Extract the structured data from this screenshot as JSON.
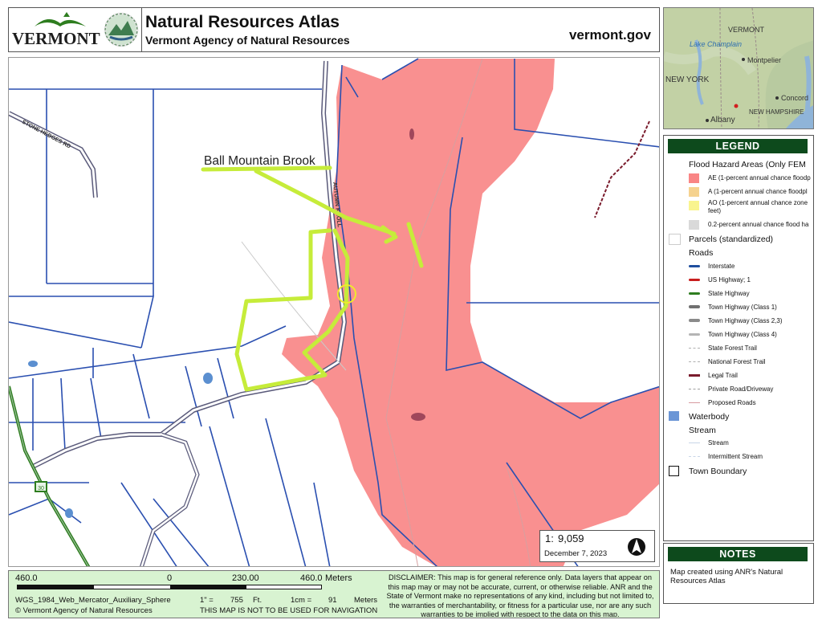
{
  "header": {
    "logo_text": "VERMONT",
    "title": "Natural Resources Atlas",
    "subtitle": "Vermont Agency of Natural Resources",
    "site": "vermont.gov"
  },
  "inset_map": {
    "labels": [
      "VERMONT",
      "Lake Champlain",
      "Montpelier",
      "NEW YORK",
      "Concord",
      "NEW HAMPSHIRE",
      "Albany"
    ]
  },
  "map": {
    "annotation": "Ball Mountain Brook",
    "road_label_1": "STONE HEDGES RD",
    "road_label_2": "AUTUMN KNOLL",
    "shield_label": "30"
  },
  "legend": {
    "title": "LEGEND",
    "flood_header": "Flood Hazard Areas (Only FEM",
    "flood_items": [
      {
        "label": "AE (1-percent annual chance floodp",
        "color": "#f98585"
      },
      {
        "label": "A (1-percent annual chance floodpl",
        "color": "#f5d28f"
      },
      {
        "label": "AO (1-percent annual chance zone",
        "label2": "feet)",
        "color": "#f9f48f"
      },
      {
        "label": "0.2-percent annual chance flood ha",
        "color": "#d9d9d9"
      }
    ],
    "parcels": "Parcels (standardized)",
    "roads_header": "Roads",
    "road_items": [
      {
        "label": "Interstate",
        "color": "#1f4e9e"
      },
      {
        "label": "US Highway; 1",
        "color": "#c81e1e"
      },
      {
        "label": "State Highway",
        "color": "#2e7d1f"
      },
      {
        "label": "Town Highway (Class 1)",
        "color": "#707070"
      },
      {
        "label": "Town Highway (Class 2,3)",
        "color": "#8a8a8a"
      },
      {
        "label": "Town Highway (Class 4)",
        "color": "#b5b5b5"
      },
      {
        "label": "State Forest Trail",
        "color": "#b0b0b0"
      },
      {
        "label": "National Forest Trail",
        "color": "#b0b0b0"
      },
      {
        "label": "Legal Trail",
        "color": "#7a1b2c"
      },
      {
        "label": "Private Road/Driveway",
        "color": "#a0a0a0"
      },
      {
        "label": "Proposed Roads",
        "color": "#d79aa0"
      }
    ],
    "waterbody": "Waterbody",
    "stream_header": "Stream",
    "stream_items": [
      "Stream",
      "Intermittent Stream"
    ],
    "town_boundary": "Town Boundary"
  },
  "scale": {
    "ratio_prefix": "1:",
    "ratio_value": "9,059",
    "date": "December 7, 2023"
  },
  "notes": {
    "title": "NOTES",
    "text": "Map created using ANR's Natural Resources Atlas"
  },
  "scalebar": {
    "left_value": "460.0",
    "zero": "0",
    "mid_value": "230.00",
    "right_value": "460.0",
    "units": "Meters",
    "projection": "WGS_1984_Web_Mercator_Auxiliary_Sphere",
    "inch_line": "1\" =",
    "inch_value": "755",
    "inch_unit": "Ft.",
    "cm_line": "1cm =",
    "cm_value": "91",
    "cm_unit": "Meters",
    "copyright": "© Vermont Agency of Natural Resources",
    "nav_warning": "THIS MAP IS NOT TO BE USED FOR NAVIGATION",
    "disclaimer": "DISCLAIMER: This map is for general reference only. Data layers that appear on this map may or may not be accurate, current, or otherwise reliable. ANR and the State of Vermont make no representations of any kind, including but not limited to, the warranties of merchantability, or fitness for a particular use, nor are any such warranties to be implied with respect to the data on this map."
  }
}
